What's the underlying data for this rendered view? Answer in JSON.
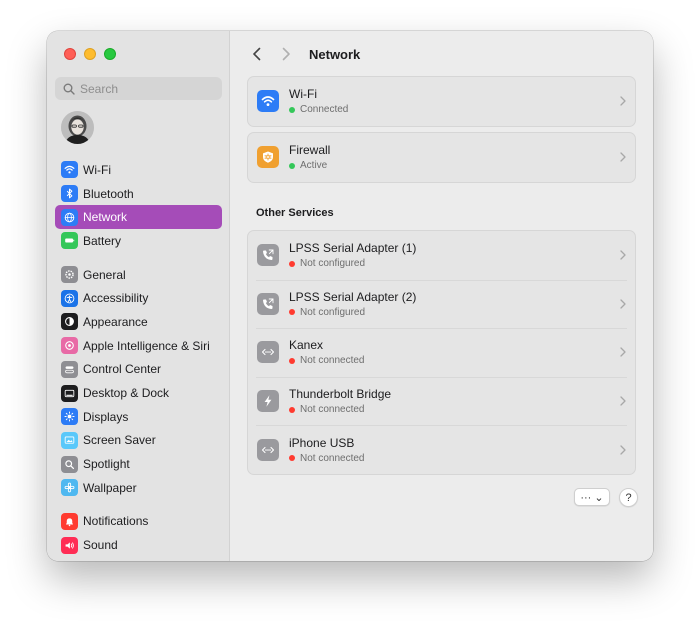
{
  "window": {
    "title": "Network"
  },
  "search": {
    "placeholder": "Search"
  },
  "sidebar": {
    "groups": [
      [
        {
          "label": "Wi-Fi",
          "icon": "wifi-icon",
          "color": "#2d7cf6"
        },
        {
          "label": "Bluetooth",
          "icon": "bluetooth-icon",
          "color": "#2d7cf6"
        },
        {
          "label": "Network",
          "icon": "globe-icon",
          "color": "#2d7cf6",
          "active": true
        },
        {
          "label": "Battery",
          "icon": "battery-icon",
          "color": "#34c759"
        }
      ],
      [
        {
          "label": "General",
          "icon": "gear-icon",
          "color": "#8e8e93"
        },
        {
          "label": "Accessibility",
          "icon": "accessibility-icon",
          "color": "#1a73e8"
        },
        {
          "label": "Appearance",
          "icon": "appearance-icon",
          "color": "#1d1d1f"
        },
        {
          "label": "Apple Intelligence & Siri",
          "icon": "siri-icon",
          "color": "#e86aa6"
        },
        {
          "label": "Control Center",
          "icon": "control-center-icon",
          "color": "#8e8e93"
        },
        {
          "label": "Desktop & Dock",
          "icon": "dock-icon",
          "color": "#1d1d1f"
        },
        {
          "label": "Displays",
          "icon": "displays-icon",
          "color": "#2d7cf6"
        },
        {
          "label": "Screen Saver",
          "icon": "screen-saver-icon",
          "color": "#5ac8fa"
        },
        {
          "label": "Spotlight",
          "icon": "spotlight-icon",
          "color": "#8e8e93"
        },
        {
          "label": "Wallpaper",
          "icon": "wallpaper-icon",
          "color": "#4fb8f0"
        }
      ],
      [
        {
          "label": "Notifications",
          "icon": "notifications-icon",
          "color": "#ff3b30"
        },
        {
          "label": "Sound",
          "icon": "sound-icon",
          "color": "#ff2d55"
        }
      ]
    ]
  },
  "primary": [
    {
      "name": "Wi-Fi",
      "status": "Connected",
      "status_color": "#34c759",
      "icon": "wifi-icon",
      "icon_color": "#2d7cf6"
    },
    {
      "name": "Firewall",
      "status": "Active",
      "status_color": "#34c759",
      "icon": "firewall-icon",
      "icon_color": "#f0a030"
    }
  ],
  "other_services": {
    "label": "Other Services",
    "items": [
      {
        "name": "LPSS Serial Adapter (1)",
        "status": "Not configured",
        "status_color": "#ff3b30",
        "icon": "phone-icon"
      },
      {
        "name": "LPSS Serial Adapter (2)",
        "status": "Not configured",
        "status_color": "#ff3b30",
        "icon": "phone-icon"
      },
      {
        "name": "Kanex",
        "status": "Not connected",
        "status_color": "#ff3b30",
        "icon": "ethernet-icon"
      },
      {
        "name": "Thunderbolt Bridge",
        "status": "Not connected",
        "status_color": "#ff3b30",
        "icon": "thunderbolt-icon"
      },
      {
        "name": "iPhone USB",
        "status": "Not connected",
        "status_color": "#ff3b30",
        "icon": "ethernet-icon"
      }
    ]
  },
  "footer": {
    "more_label": "··· ⌄",
    "help_label": "?"
  }
}
